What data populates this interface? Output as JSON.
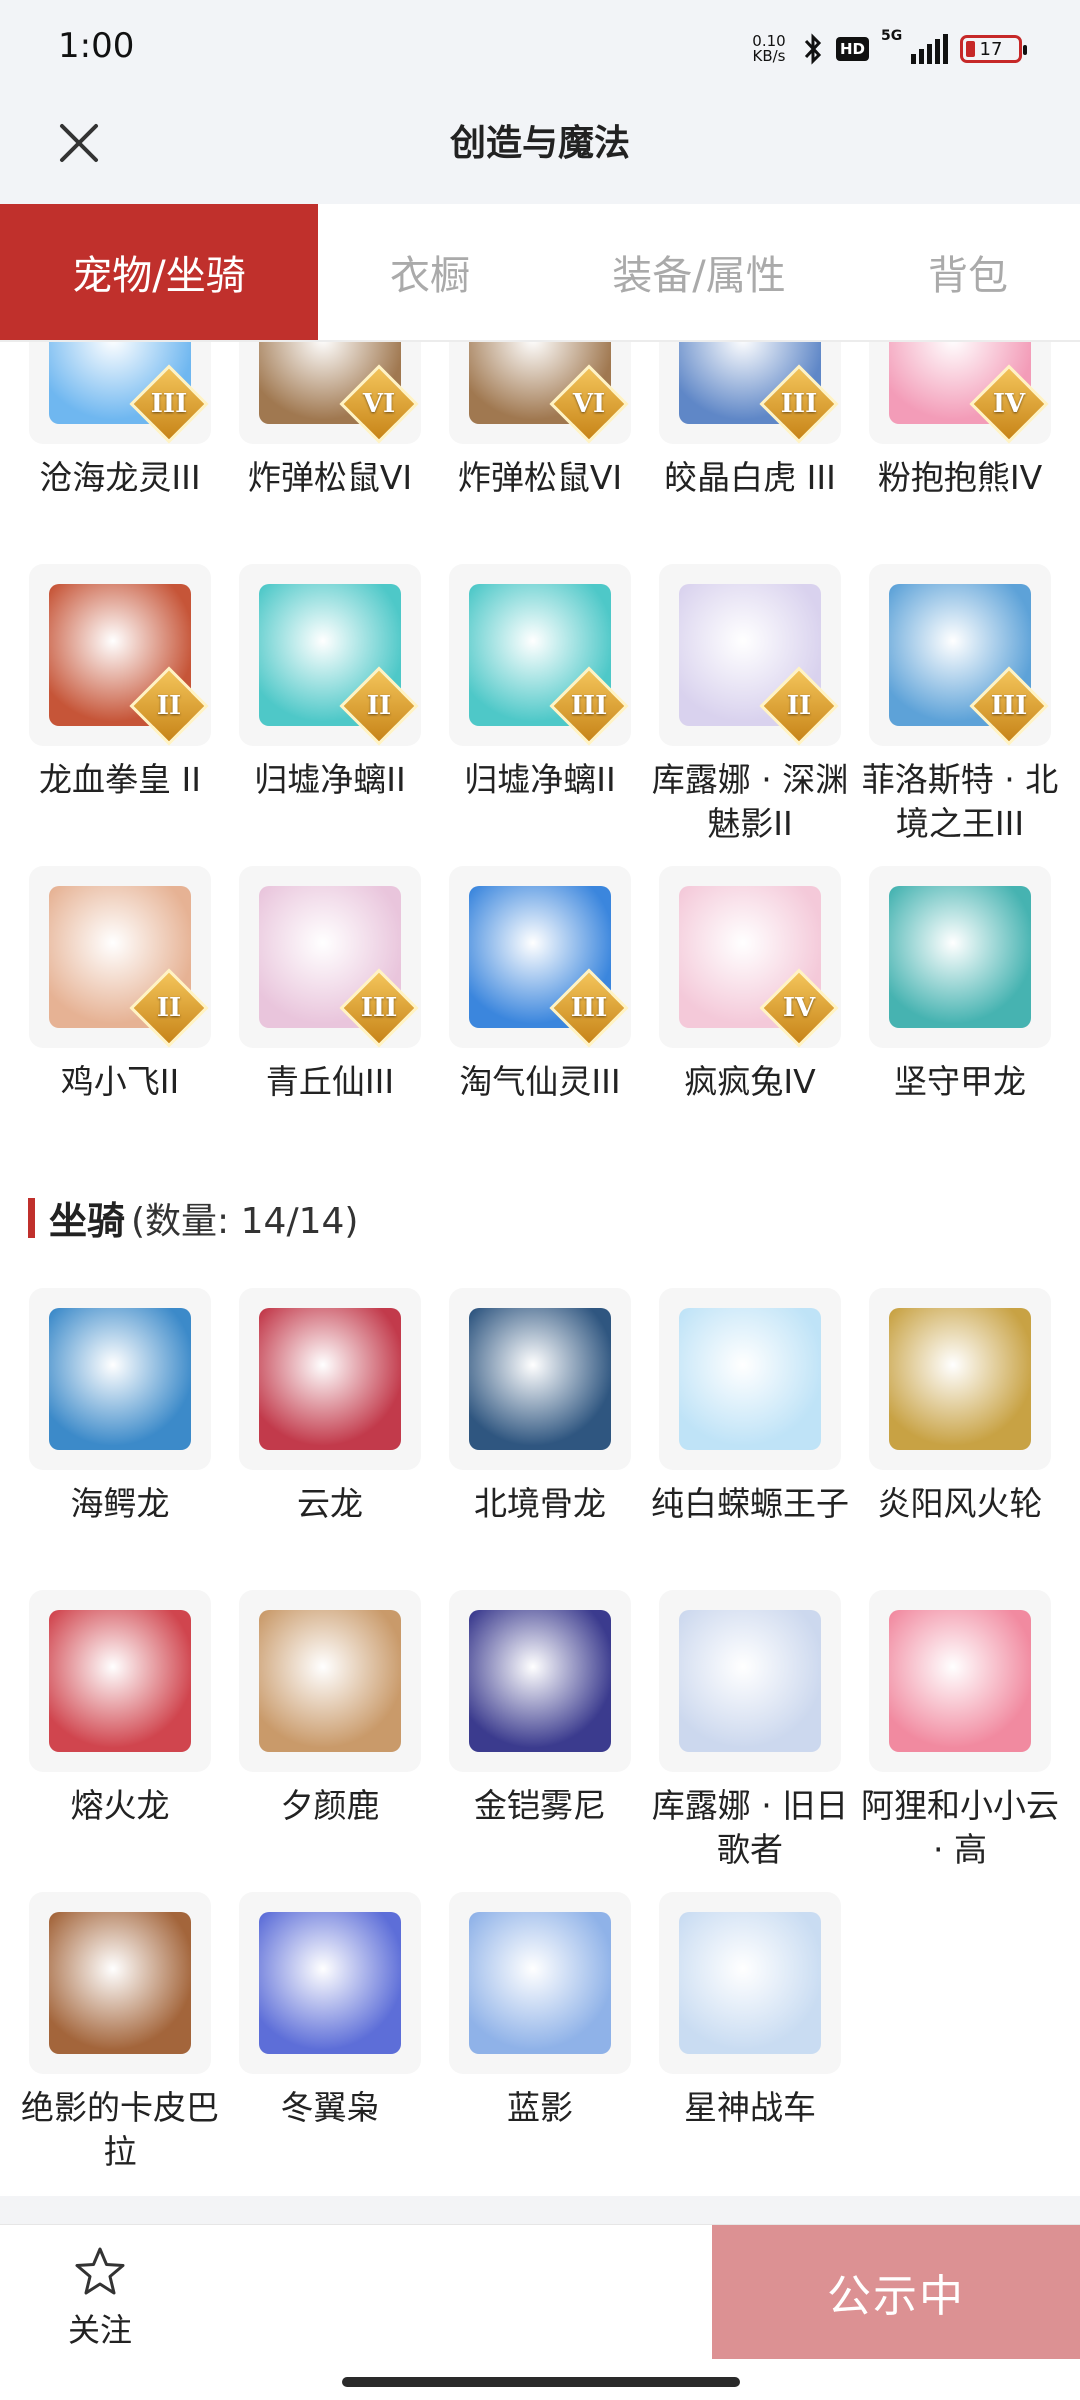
{
  "status_bar": {
    "time": "1:00",
    "net_speed_value": "0.10",
    "net_speed_unit": "KB/s",
    "hd": "HD",
    "network": "5G",
    "battery": "17",
    "battery_level_percent": 17
  },
  "header": {
    "title": "创造与魔法",
    "close_icon": "close-icon"
  },
  "tabs": [
    {
      "label": "宠物/坐骑",
      "active": true
    },
    {
      "label": "衣橱",
      "active": false
    },
    {
      "label": "装备/属性",
      "active": false
    },
    {
      "label": "背包",
      "active": false
    }
  ],
  "pets": [
    {
      "name": "沧海龙灵III",
      "rank": "III",
      "color": "#6fb7f0",
      "icon": "merman-icon"
    },
    {
      "name": "炸弹松鼠VI",
      "rank": "VI",
      "color": "#a07850",
      "icon": "squirrel-icon"
    },
    {
      "name": "炸弹松鼠VI",
      "rank": "VI",
      "color": "#a07850",
      "icon": "squirrel-icon"
    },
    {
      "name": "皎晶白虎 III",
      "rank": "III",
      "color": "#5f87c7",
      "icon": "tiger-icon"
    },
    {
      "name": "粉抱抱熊IV",
      "rank": "IV",
      "color": "#f39cb8",
      "icon": "bear-icon"
    },
    {
      "name": "龙血拳皇 II",
      "rank": "II",
      "color": "#c65538",
      "icon": "ox-icon"
    },
    {
      "name": "归墟净螭II",
      "rank": "II",
      "color": "#4ec8c8",
      "icon": "dragon-icon"
    },
    {
      "name": "归墟净螭II",
      "rank": "III",
      "color": "#4ec8c8",
      "icon": "dragon-icon"
    },
    {
      "name": "库露娜 · 深渊魅影II",
      "rank": "II",
      "color": "#d9d2ee",
      "icon": "mermaid-icon"
    },
    {
      "name": "菲洛斯特 · 北境之王III",
      "rank": "III",
      "color": "#5da2d8",
      "icon": "ice-king-icon"
    },
    {
      "name": "鸡小飞II",
      "rank": "II",
      "color": "#e6b294",
      "icon": "chick-icon"
    },
    {
      "name": "青丘仙III",
      "rank": "III",
      "color": "#e9c5dc",
      "icon": "fox-fairy-icon"
    },
    {
      "name": "淘气仙灵III",
      "rank": "III",
      "color": "#3b86dd",
      "icon": "puppy-icon"
    },
    {
      "name": "疯疯兔IV",
      "rank": "IV",
      "color": "#f4c9d9",
      "icon": "rabbit-icon"
    },
    {
      "name": "坚守甲龙",
      "rank": "",
      "color": "#46b3b1",
      "icon": "ankylosaur-icon"
    }
  ],
  "mounts_section": {
    "title": "坐骑",
    "count": "(数量: 14/14)"
  },
  "mounts": [
    {
      "name": "海鳄龙",
      "color": "#3c8ac9",
      "icon": "sea-dragon-icon"
    },
    {
      "name": "云龙",
      "color": "#c23a4b",
      "icon": "cloud-dragon-icon"
    },
    {
      "name": "北境骨龙",
      "color": "#2f5680",
      "icon": "bone-dragon-icon"
    },
    {
      "name": "纯白蝾螈王子",
      "color": "#bfe3f7",
      "icon": "axolotl-icon"
    },
    {
      "name": "炎阳风火轮",
      "color": "#c8a244",
      "icon": "wheel-icon"
    },
    {
      "name": "熔火龙",
      "color": "#d0454e",
      "icon": "lava-dragon-icon"
    },
    {
      "name": "夕颜鹿",
      "color": "#c99a6a",
      "icon": "deer-icon"
    },
    {
      "name": "金铠雾尼",
      "color": "#3b3b8e",
      "icon": "armored-beast-icon"
    },
    {
      "name": "库露娜 · 旧日歌者",
      "color": "#ccd8ee",
      "icon": "singer-icon"
    },
    {
      "name": "阿狸和小小云 · 高",
      "color": "#f18aa0",
      "icon": "fox-cloud-icon"
    },
    {
      "name": "绝影的卡皮巴拉",
      "color": "#a3653b",
      "icon": "capybara-icon"
    },
    {
      "name": "冬翼枭",
      "color": "#5d6ed8",
      "icon": "owl-icon"
    },
    {
      "name": "蓝影",
      "color": "#8fb2e8",
      "icon": "white-tiger-icon"
    },
    {
      "name": "星神战车",
      "color": "#c9dcf2",
      "icon": "unicorn-icon"
    }
  ],
  "bottom": {
    "follow_label": "关注",
    "status_label": "公示中"
  }
}
